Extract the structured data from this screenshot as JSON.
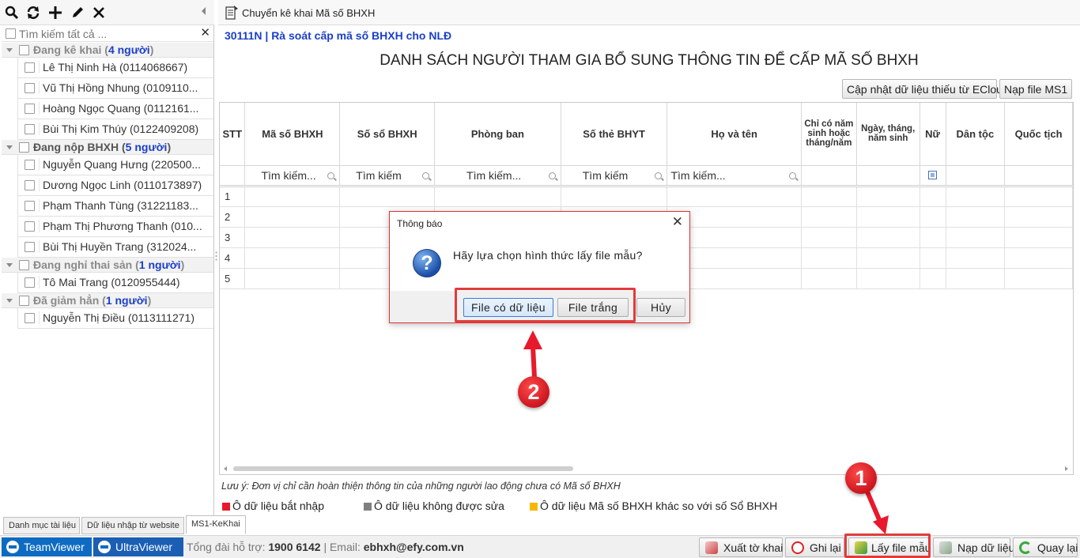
{
  "left_panel": {
    "search_placeholder": "Tìm kiếm tất cả ...",
    "groups": [
      {
        "label": "Đang kê khai",
        "count_text": "4 người",
        "people": [
          "Lê Thị Ninh Hà (0114068667)",
          "Vũ Thị Hồng Nhung (0109110...",
          "Hoàng Ngọc Quang (0112161...",
          "Bùi Thị Kim Thúy (0122409208)"
        ]
      },
      {
        "label": "Đang nộp BHXH",
        "count_text": "5 người",
        "people": [
          "Nguyễn Quang Hưng (220500...",
          "Dương Ngọc Linh (0110173897)",
          "Phạm Thanh Tùng (31221183...",
          "Phạm Thị Phương Thanh (010...",
          "Bùi Thị Huyền Trang (312024..."
        ]
      },
      {
        "label": "Đang nghỉ thai sản",
        "count_text": "1 người",
        "people": [
          "Tô Mai Trang (0120955444)"
        ]
      },
      {
        "label": "Đã giảm hẳn",
        "count_text": "1 người",
        "people": [
          "Nguyễn Thị Điều (0113111271)"
        ]
      }
    ]
  },
  "bottom_tabs": [
    "Danh mục tài liệu",
    "Dữ liệu nhập từ website",
    "MS1-KeKhai"
  ],
  "main": {
    "header_title": "Chuyển kê khai Mã số BHXH",
    "report_code": "30111N | Rà soát cấp mã số BHXH cho NLĐ",
    "report_title": "DANH SÁCH NGƯỜI THAM GIA BỔ SUNG THÔNG TIN ĐỂ CẤP MÃ SỐ BHXH",
    "top_buttons": [
      "Cập nhật dữ liệu thiếu từ ECloud",
      "Nạp file MS1"
    ],
    "columns": [
      "STT",
      "Mã số BHXH",
      "Số sổ BHXH",
      "Phòng ban",
      "Số thẻ BHYT",
      "Họ và tên",
      "Chỉ có năm sinh hoặc tháng/năm",
      "Ngày, tháng, năm sinh",
      "Nữ",
      "Dân tộc",
      "Quốc tịch"
    ],
    "filter_placeholder": "Tìm kiếm...",
    "filter_placeholder_short": "Tìm kiếm",
    "row_numbers": [
      "1",
      "2",
      "3",
      "4",
      "5"
    ],
    "note": "Lưu ý: Đơn vị chỉ cần hoàn thiện thông tin của những người lao động chưa có Mã số BHXH",
    "legend": [
      {
        "label": "Ô dữ liệu bắt nhập",
        "color": "#e8192c"
      },
      {
        "label": "Ô dữ liệu không được sửa",
        "color": "#7f7f7f"
      },
      {
        "label": "Ô dữ liệu Mã số BHXH khác so với số Sổ BHXH",
        "color": "#f5b800"
      }
    ]
  },
  "dialog": {
    "title": "Thông báo",
    "close": "✕",
    "icon": "question-icon",
    "message": "Hãy lựa chọn hình thức lấy file mẫu?",
    "buttons": [
      "File có dữ liệu",
      "File trắng",
      "Hủy"
    ]
  },
  "status_bar": {
    "teamviewer": "TeamViewer",
    "ultraviewer": "UltraViewer",
    "support_label": "Tổng đài hỗ trợ:",
    "support_phone": "1900 6142",
    "email_label": "Email:",
    "email": "ebhxh@efy.com.vn",
    "separator": "|"
  },
  "action_buttons": [
    "Xuất tờ khai",
    "Ghi lại",
    "Lấy file mẫu",
    "Nạp dữ liệu",
    "Quay lại"
  ],
  "callouts": [
    "1",
    "2"
  ],
  "colors": {
    "accent_blue": "#1a3fc8",
    "annotation_red": "#e23b3b",
    "teamviewer_blue": "#0e6bc3"
  }
}
